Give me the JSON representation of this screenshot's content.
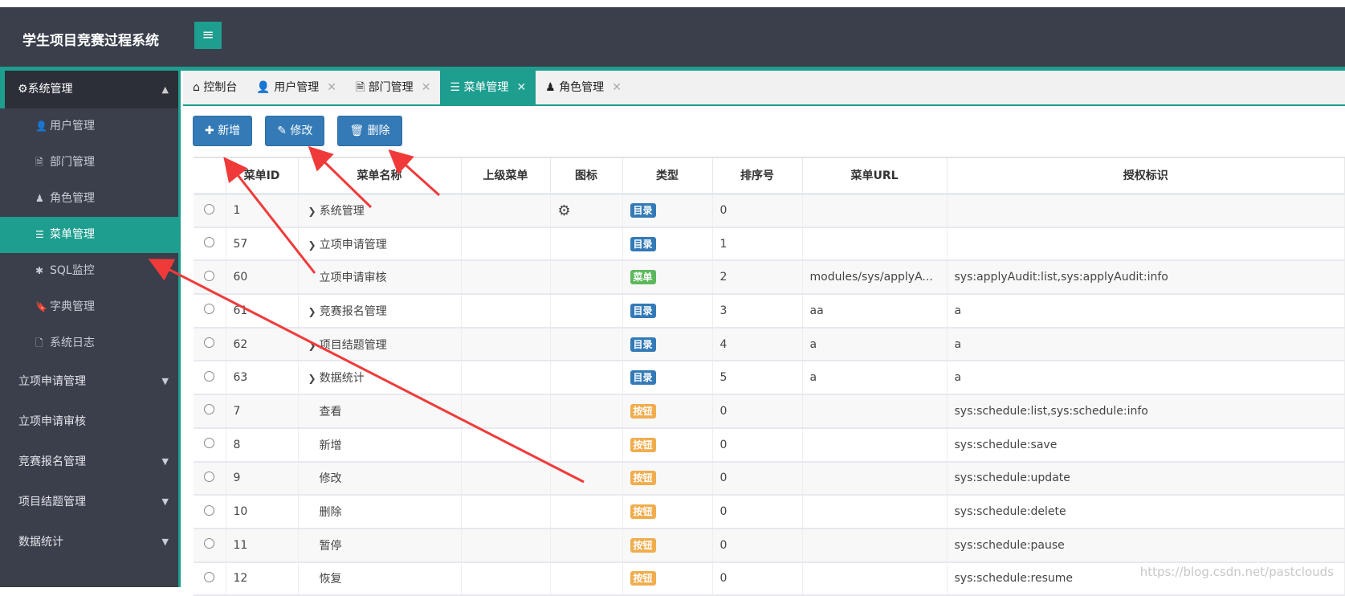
{
  "header": {
    "title": "学生项目竞赛过程系统",
    "menu_toggle_icon": "≡"
  },
  "sidebar": {
    "section": {
      "label": "系统管理",
      "icon": "gear-icon"
    },
    "sub_items": [
      {
        "label": "用户管理",
        "icon": "user-icon",
        "glyph": "👤"
      },
      {
        "label": "部门管理",
        "icon": "file-icon",
        "glyph": "🗎"
      },
      {
        "label": "角色管理",
        "icon": "role-icon",
        "glyph": "♟"
      },
      {
        "label": "菜单管理",
        "icon": "list-icon",
        "glyph": "☰",
        "active": true
      },
      {
        "label": "SQL监控",
        "icon": "bug-icon",
        "glyph": "✱"
      },
      {
        "label": "字典管理",
        "icon": "bookmark-icon",
        "glyph": "🔖"
      },
      {
        "label": "系统日志",
        "icon": "document-icon",
        "glyph": "🗋"
      }
    ],
    "groups": [
      {
        "label": "立项申请管理",
        "caret": true
      },
      {
        "label": "立项申请审核",
        "caret": false
      },
      {
        "label": "竞赛报名管理",
        "caret": true
      },
      {
        "label": "项目结题管理",
        "caret": true
      },
      {
        "label": "数据统计",
        "caret": true
      }
    ]
  },
  "tabs": [
    {
      "label": "控制台",
      "glyph": "⌂",
      "closable": false
    },
    {
      "label": "用户管理",
      "glyph": "👤",
      "closable": true
    },
    {
      "label": "部门管理",
      "glyph": "🗎",
      "closable": true
    },
    {
      "label": "菜单管理",
      "glyph": "☰",
      "closable": true,
      "active": true
    },
    {
      "label": "角色管理",
      "glyph": "♟",
      "closable": true
    }
  ],
  "toolbar": {
    "add": "新增",
    "edit": "修改",
    "delete": "删除"
  },
  "table": {
    "headers": [
      "",
      "菜单ID",
      "菜单名称",
      "上级菜单",
      "图标",
      "类型",
      "排序号",
      "菜单URL",
      "授权标识"
    ],
    "rows": [
      {
        "id": "1",
        "name": "系统管理",
        "expand": true,
        "parent": "",
        "icon": "gear",
        "type": "目录",
        "order": "0",
        "url": "",
        "perms": ""
      },
      {
        "id": "57",
        "name": "立项申请管理",
        "expand": true,
        "parent": "",
        "icon": "",
        "type": "目录",
        "order": "1",
        "url": "",
        "perms": ""
      },
      {
        "id": "60",
        "name": "立项申请审核",
        "expand": false,
        "parent": "",
        "icon": "",
        "type": "菜单",
        "order": "2",
        "url": "modules/sys/applyA...",
        "perms": "sys:applyAudit:list,sys:applyAudit:info"
      },
      {
        "id": "61",
        "name": "竞赛报名管理",
        "expand": true,
        "parent": "",
        "icon": "",
        "type": "目录",
        "order": "3",
        "url": "aa",
        "perms": "a"
      },
      {
        "id": "62",
        "name": "项目结题管理",
        "expand": true,
        "parent": "",
        "icon": "",
        "type": "目录",
        "order": "4",
        "url": "a",
        "perms": "a"
      },
      {
        "id": "63",
        "name": "数据统计",
        "expand": true,
        "parent": "",
        "icon": "",
        "type": "目录",
        "order": "5",
        "url": "a",
        "perms": "a"
      },
      {
        "id": "7",
        "name": "查看",
        "expand": false,
        "parent": "",
        "icon": "",
        "type": "按钮",
        "order": "0",
        "url": "",
        "perms": "sys:schedule:list,sys:schedule:info"
      },
      {
        "id": "8",
        "name": "新增",
        "expand": false,
        "parent": "",
        "icon": "",
        "type": "按钮",
        "order": "0",
        "url": "",
        "perms": "sys:schedule:save"
      },
      {
        "id": "9",
        "name": "修改",
        "expand": false,
        "parent": "",
        "icon": "",
        "type": "按钮",
        "order": "0",
        "url": "",
        "perms": "sys:schedule:update"
      },
      {
        "id": "10",
        "name": "删除",
        "expand": false,
        "parent": "",
        "icon": "",
        "type": "按钮",
        "order": "0",
        "url": "",
        "perms": "sys:schedule:delete"
      },
      {
        "id": "11",
        "name": "暂停",
        "expand": false,
        "parent": "",
        "icon": "",
        "type": "按钮",
        "order": "0",
        "url": "",
        "perms": "sys:schedule:pause"
      },
      {
        "id": "12",
        "name": "恢复",
        "expand": false,
        "parent": "",
        "icon": "",
        "type": "按钮",
        "order": "0",
        "url": "",
        "perms": "sys:schedule:resume"
      }
    ]
  },
  "type_colors": {
    "目录": "#337ab7",
    "菜单": "#5cb85c",
    "按钮": "#f0ad4e"
  },
  "watermark": "https://blog.csdn.net/pastclouds"
}
